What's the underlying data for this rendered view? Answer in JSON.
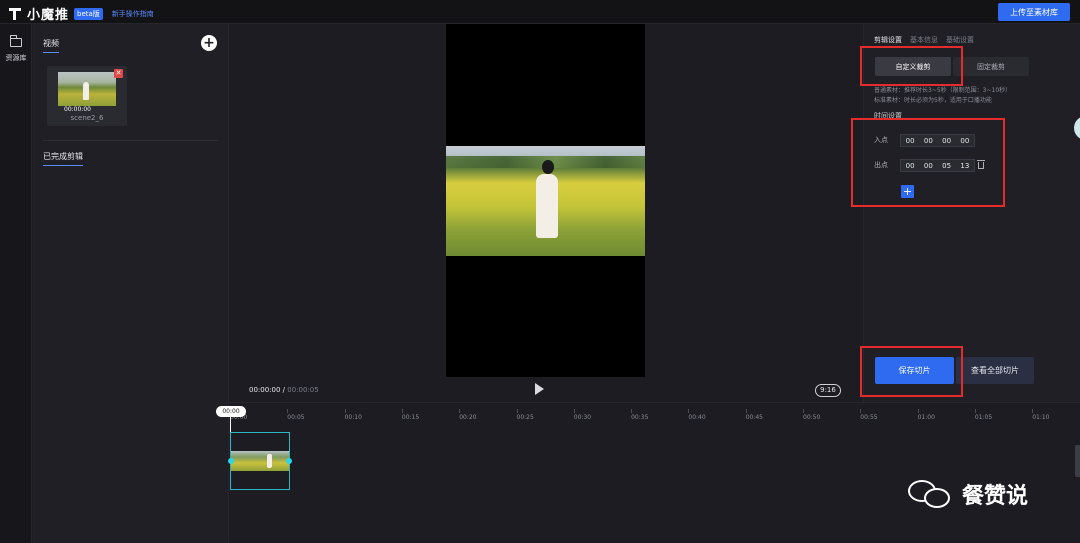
{
  "topbar": {
    "logo_text": "小魔推",
    "beta_badge": "beta版",
    "guide_link": "新手操作指南",
    "upload_label": "上传至素材库"
  },
  "rail": {
    "library_label": "资源库"
  },
  "library": {
    "tab_video": "视频",
    "add_symbol": "+",
    "clip": {
      "time": "00:00:00",
      "name": "scene2_6"
    },
    "done_tab": "已完成剪辑"
  },
  "player": {
    "current_time": "00:00:00",
    "separator": " / ",
    "total_time": "00:00:05",
    "ratio": "9:16"
  },
  "settings": {
    "tabs": [
      "剪辑设置",
      "基本信息",
      "基础设置"
    ],
    "mode_custom": "自定义裁剪",
    "mode_fixed": "固定裁剪",
    "note_line1": "普通素材：推荐时长3~5秒（限制范围：3~10秒）",
    "note_line2": "标准素材：时长必须为5秒，适用于口播功能",
    "time_title": "时间设置",
    "in_label": "入点",
    "in_values": [
      "00",
      "00",
      "00",
      "00"
    ],
    "out_label": "出点",
    "out_values": [
      "00",
      "00",
      "05",
      "13"
    ],
    "add_symbol": "+",
    "save_label": "保存切片",
    "view_all_label": "查看全部切片"
  },
  "timeline": {
    "playhead": "00:00",
    "ticks": [
      "00:00",
      "00:05",
      "00:10",
      "00:15",
      "00:20",
      "00:25",
      "00:30",
      "00:35",
      "00:40",
      "00:45",
      "00:50",
      "00:55",
      "01:00",
      "01:05",
      "01:10"
    ]
  },
  "watermark": {
    "text": "餐赞说"
  },
  "colors": {
    "accent": "#2e6bf0",
    "highlight_box": "#e52b2b",
    "clip_border": "#2bb6c6"
  }
}
